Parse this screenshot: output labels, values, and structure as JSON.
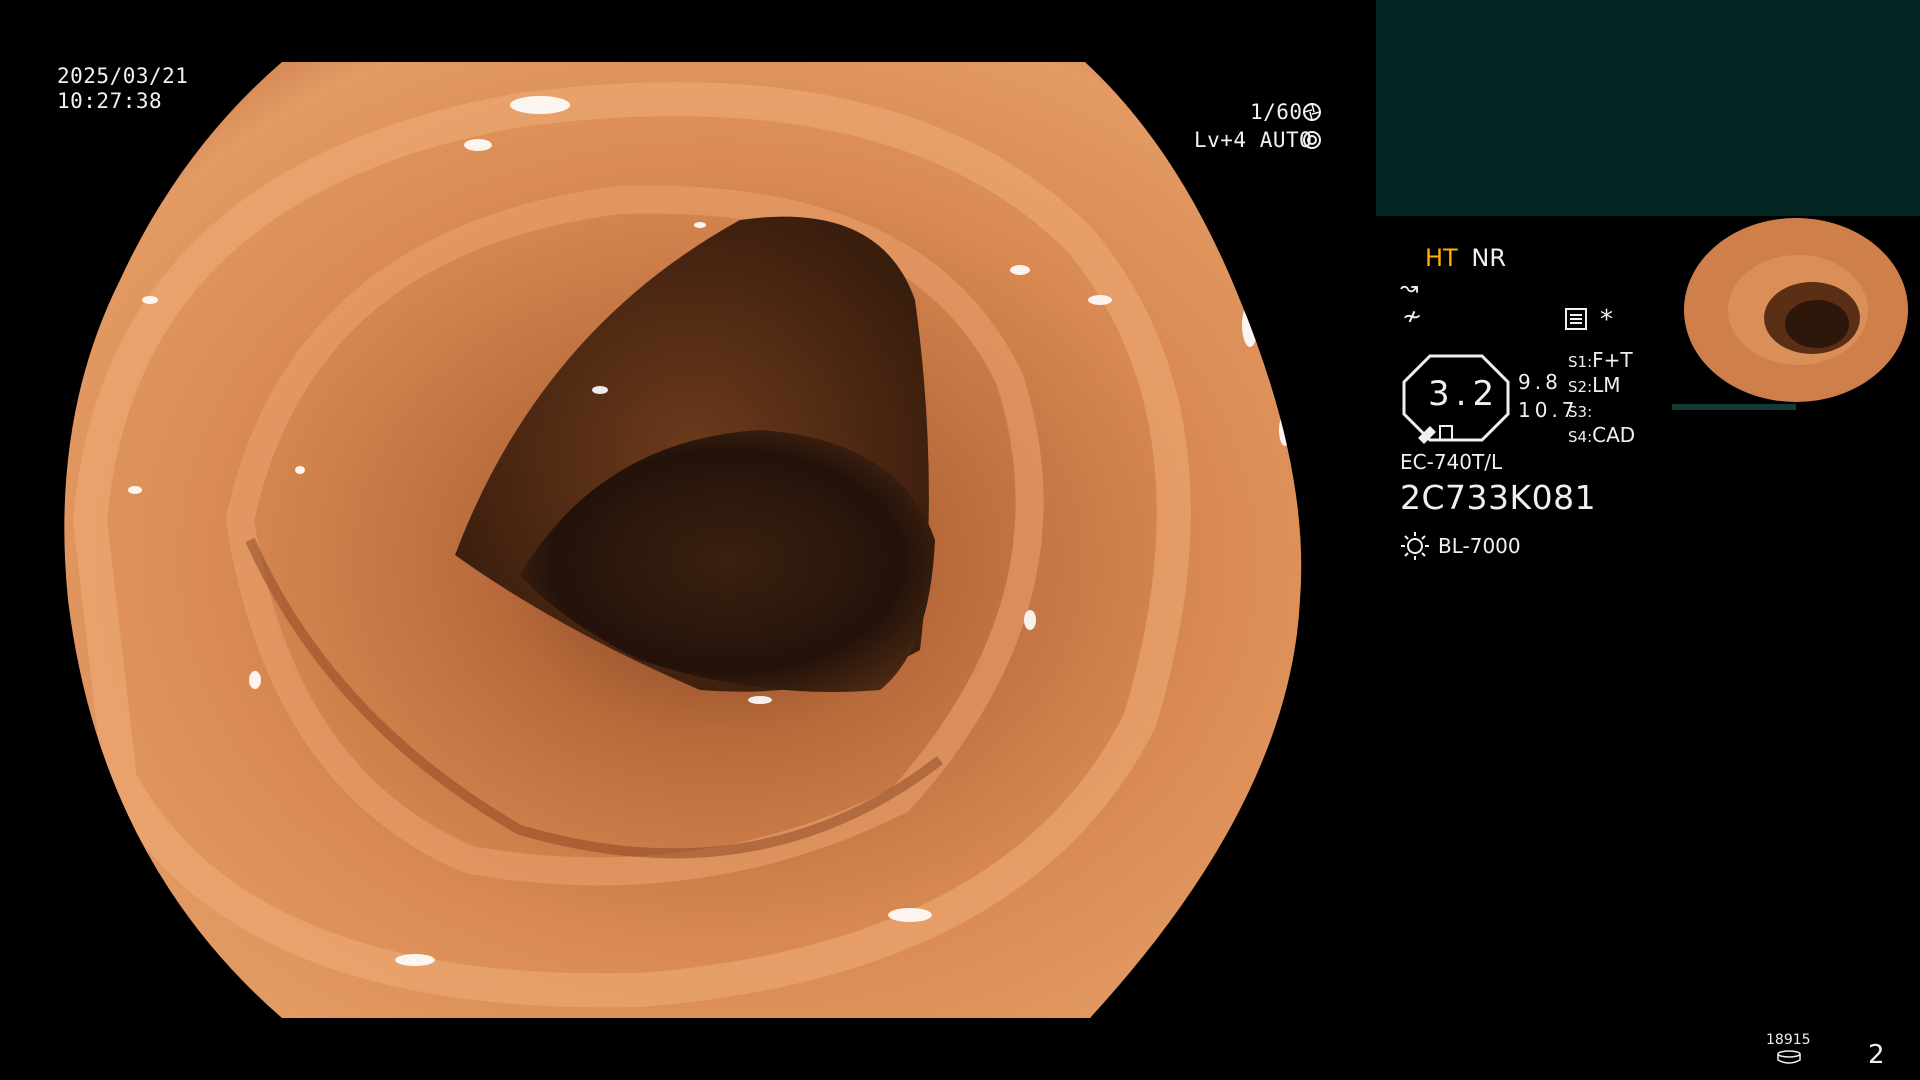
{
  "colors": {
    "background": "#000000",
    "panel": "#022521",
    "mucosa": "#d98a52",
    "lumen": "#2b160b",
    "accent_orange": "#ffb000"
  },
  "overlay": {
    "date": "2025/03/21",
    "time": "10:27:38",
    "shutter": "1/60",
    "level": "Lv+4 AUTO"
  },
  "status": {
    "ht": "HT",
    "nr": "NR",
    "zoom": "3.2",
    "val_top": "9.8",
    "val_bottom": "10.7",
    "s1": "S1:",
    "s1_val": "F+T",
    "s2": "S2:",
    "s2_val": "LM",
    "s3": "S3:",
    "s3_val": "",
    "s4": "S4:",
    "s4_val": "CAD",
    "scope_model": "EC-740T/L",
    "serial": "2C733K081",
    "light": "BL-7000"
  },
  "footer": {
    "counter": "18915",
    "page": "2"
  },
  "icons": [
    "shutter-icon",
    "aperture-icon",
    "tilde-icon",
    "fnot-icon",
    "menu-icon",
    "asterisk-icon",
    "light-source-icon",
    "disk-icon"
  ]
}
